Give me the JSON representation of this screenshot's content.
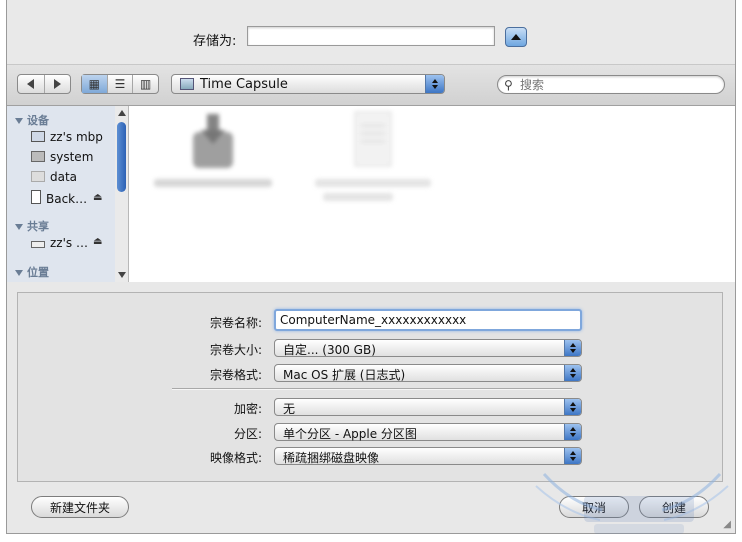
{
  "save_as": {
    "label": "存储为:",
    "value": ""
  },
  "toolbar": {
    "location": "Time Capsule",
    "search_placeholder": "搜索",
    "view_icons": [
      "icon-view-icon",
      "list-view-icon",
      "column-view-icon"
    ]
  },
  "sidebar": {
    "sections": [
      {
        "title": "设备",
        "items": [
          {
            "label": "zz's mbp",
            "icon": "laptop-icon"
          },
          {
            "label": "system",
            "icon": "disk-icon"
          },
          {
            "label": "data",
            "icon": "disk-icon"
          },
          {
            "label": "Back…",
            "icon": "drive-icon",
            "eject": true
          }
        ]
      },
      {
        "title": "共享",
        "items": [
          {
            "label": "zz's …",
            "icon": "server-icon",
            "eject": true
          }
        ]
      },
      {
        "title": "位置",
        "items": []
      }
    ]
  },
  "files": [],
  "options": {
    "volume_name": {
      "label": "宗卷名称:",
      "value": "ComputerName_xxxxxxxxxxxx"
    },
    "volume_size": {
      "label": "宗卷大小:",
      "value": "自定... (300 GB)"
    },
    "volume_format": {
      "label": "宗卷格式:",
      "value": "Mac OS 扩展 (日志式)"
    },
    "encryption": {
      "label": "加密:",
      "value": "无"
    },
    "partitions": {
      "label": "分区:",
      "value": "单个分区 - Apple 分区图"
    },
    "image_format": {
      "label": "映像格式:",
      "value": "稀疏捆绑磁盘映像"
    }
  },
  "buttons": {
    "new_folder": "新建文件夹",
    "cancel": "取消",
    "create": "创建"
  },
  "colors": {
    "accent": "#3d76c5",
    "sidebar_bg": "#dfe5ee"
  }
}
